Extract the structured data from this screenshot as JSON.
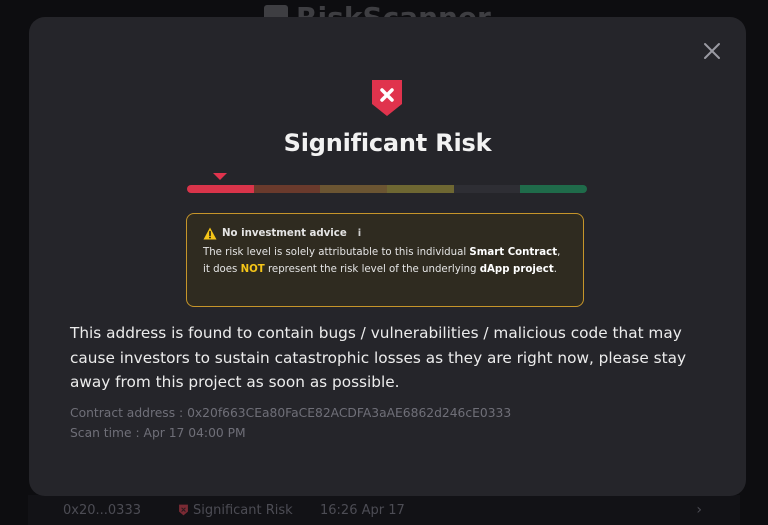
{
  "background": {
    "app_title": "RiskScanner",
    "row": {
      "address": "0x20...0333",
      "risk_label": "Significant Risk",
      "time": "16:26 Apr 17",
      "chevron": "›"
    }
  },
  "modal": {
    "title": "Significant Risk",
    "risk_meter": {
      "level_index": 0,
      "segment_colors": [
        "#d9344a",
        "#6a3a2c",
        "#6b5532",
        "#6e6732",
        "#2e2e34",
        "#1f6b4a"
      ]
    },
    "advice": {
      "heading": "No investment advice",
      "info_glyph": "i",
      "text_1": "The risk level is solely attributable to this individual ",
      "bold_1": "Smart Contract",
      "text_2": ", it does ",
      "highlight": "NOT",
      "text_3": " represent the risk level of the underlying ",
      "bold_2": "dApp project",
      "text_4": "."
    },
    "description": "This address is found to contain bugs / vulnerabilities / malicious code that may cause investors to sustain catastrophic losses as they are right now, please stay away from this project as soon as possible.",
    "contract_address": "Contract address : 0x20f663CEa80FaCE82ACDFA3aAE6862d246cE0333",
    "scan_time": "Scan time : Apr 17 04:00 PM"
  },
  "colors": {
    "accent_red": "#e0334d",
    "warning_border": "#c6952a",
    "highlight_yellow": "#f5c518"
  },
  "icons": [
    "close-icon",
    "risk-shield-icon",
    "warning-icon",
    "info-icon",
    "chevron-right-icon"
  ]
}
